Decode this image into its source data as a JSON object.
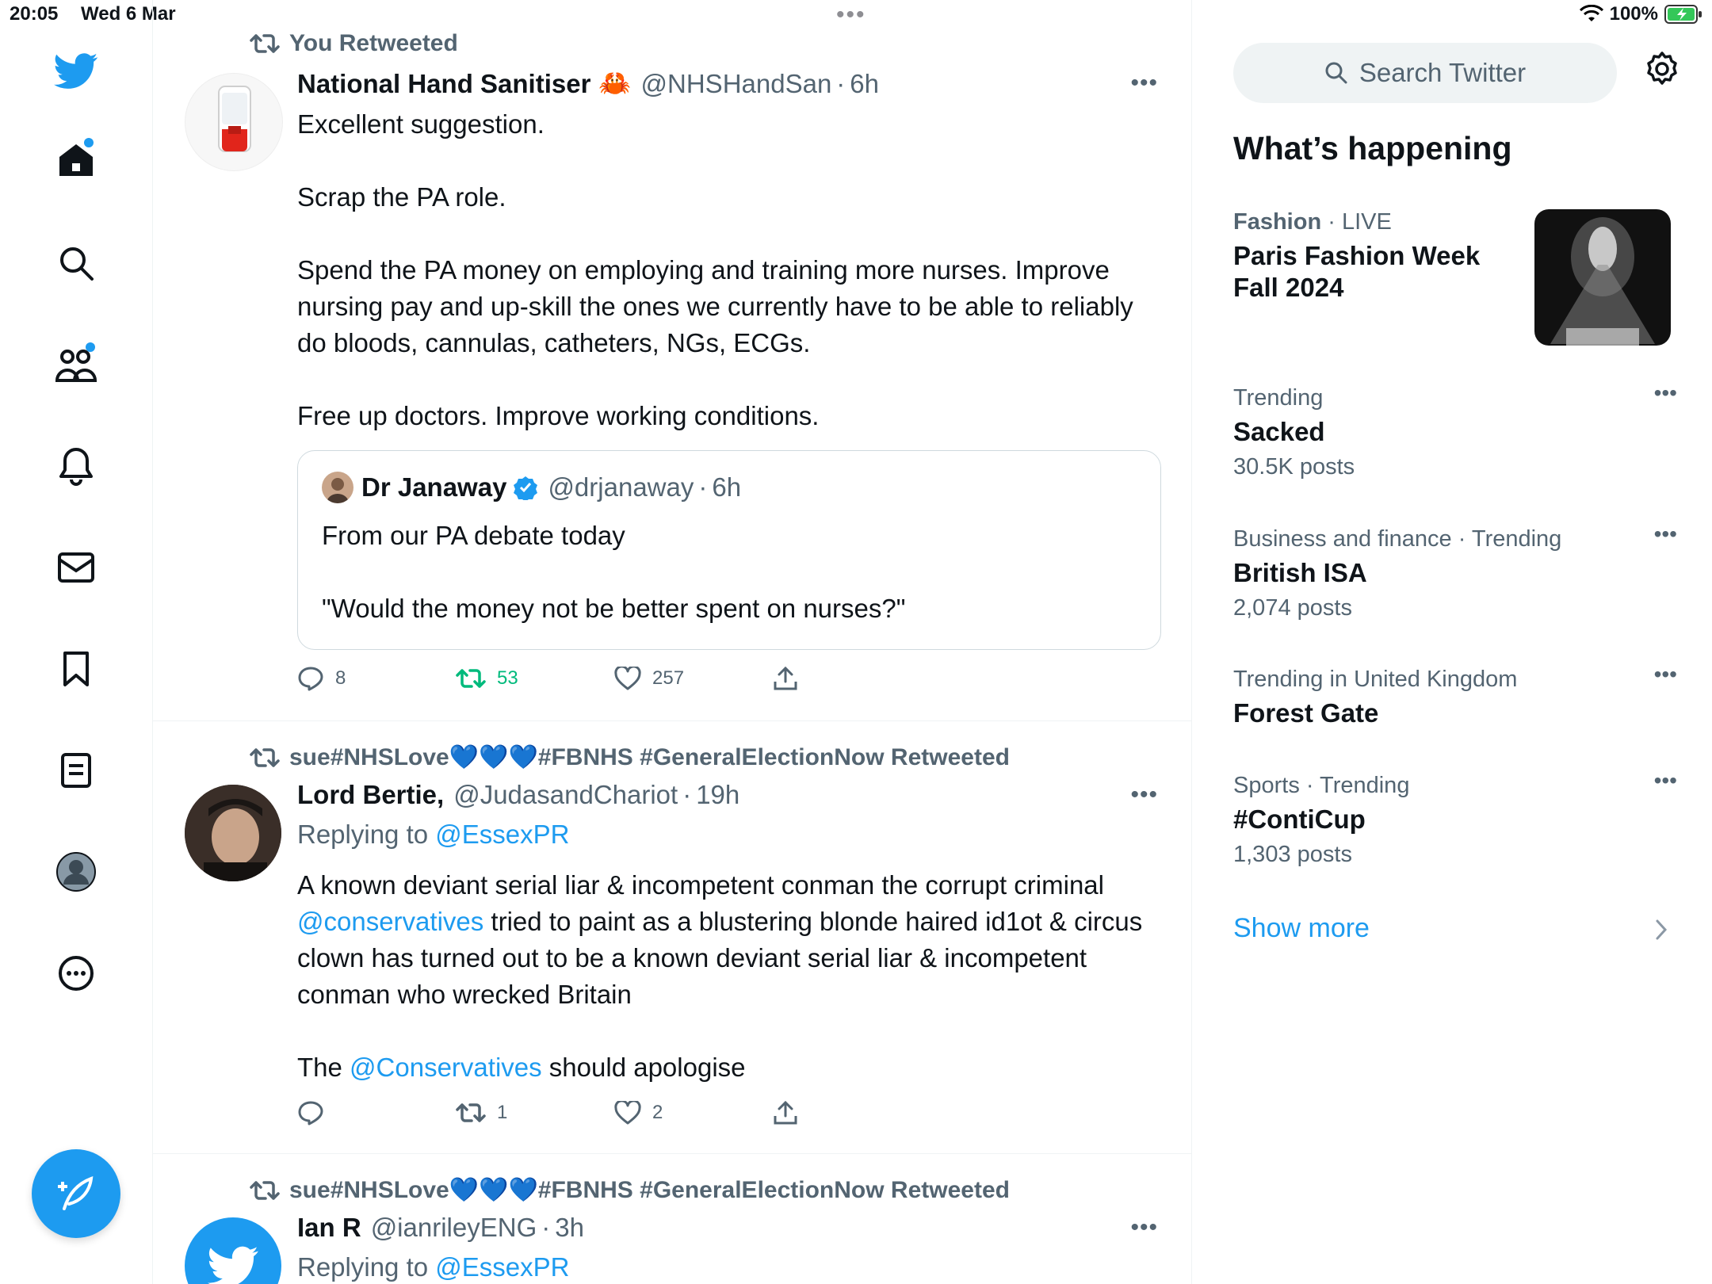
{
  "status_bar": {
    "time": "20:05",
    "date": "Wed 6 Mar",
    "battery": "100%"
  },
  "nav": {
    "items": [
      "home",
      "explore",
      "communities",
      "notifications",
      "messages",
      "bookmarks",
      "lists",
      "profile",
      "more"
    ]
  },
  "tweets": [
    {
      "retweet_label": "You Retweeted",
      "name": "National Hand Sanitiser",
      "emoji": "🦀",
      "handle": "@NHSHandSan",
      "time": "6h",
      "paragraphs": [
        "Excellent suggestion.",
        "Scrap the PA role.",
        "Spend the PA money on employing and training more nurses.  Improve nursing pay and up-skill the ones we currently have to be able to reliably do bloods, cannulas, catheters, NGs, ECGs.",
        "Free up doctors. Improve working conditions."
      ],
      "quote": {
        "name": "Dr Janaway",
        "handle": "@drjanaway",
        "time": "6h",
        "line1": "From our PA debate today",
        "line2": "\"Would the money not be better spent on nurses?\""
      },
      "replies": "8",
      "retweets": "53",
      "likes": "257"
    },
    {
      "retweet_label": "sue#NHSLove💙💙💙#FBNHS #GeneralElectionNow Retweeted",
      "name": "Lord Bertie,",
      "handle": "@JudasandChariot",
      "time": "19h",
      "replying_prefix": "Replying to ",
      "replying_handle": "@EssexPR",
      "p1_a": "A known deviant serial liar & incompetent conman the corrupt criminal ",
      "p1_link": "@conservatives",
      "p1_b": " tried to paint as a blustering blonde haired id1ot & circus clown has turned out to be a known deviant serial liar & incompetent conman who wrecked Britain",
      "p2_a": "The ",
      "p2_link": "@Conservatives",
      "p2_b": " should apologise",
      "retweets": "1",
      "likes": "2"
    },
    {
      "retweet_label": "sue#NHSLove💙💙💙#FBNHS #GeneralElectionNow Retweeted",
      "name": "Ian R",
      "handle": "@ianrileyENG",
      "time": "3h",
      "replying_prefix": "Replying to ",
      "replying_handle": "@EssexPR"
    }
  ],
  "sidebar": {
    "search_placeholder": "Search Twitter",
    "title": "What’s happening",
    "trends": [
      {
        "category": "Fashion",
        "meta": "LIVE",
        "name_line1": "Paris Fashion Week",
        "name_line2": "Fall 2024"
      },
      {
        "meta": "Trending",
        "name": "Sacked",
        "count": "30.5K posts"
      },
      {
        "meta": "Business and finance · Trending",
        "name": "British ISA",
        "count": "2,074 posts"
      },
      {
        "meta": "Trending in United Kingdom",
        "name": "Forest Gate"
      },
      {
        "meta": "Sports · Trending",
        "name": "#ContiCup",
        "count": "1,303 posts"
      }
    ],
    "show_more": "Show more"
  },
  "colors": {
    "accent": "#1d9bf0",
    "retweet_green": "#00ba7c",
    "secondary_text": "#536471"
  }
}
